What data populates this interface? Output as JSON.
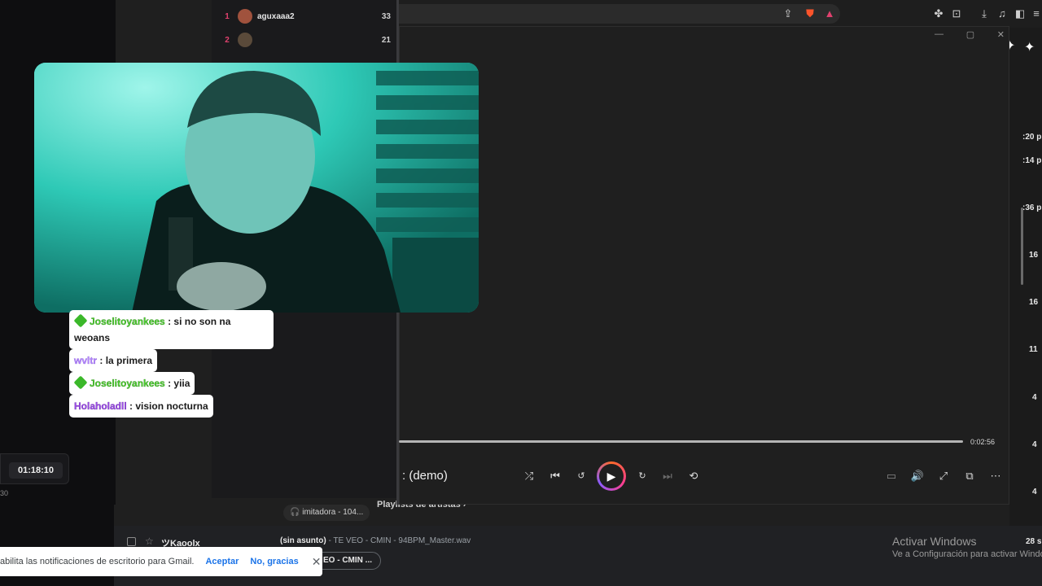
{
  "browser": {
    "icons": [
      "share-icon",
      "brave-icon",
      "rewards-icon",
      "extensions-icon",
      "screenshot-icon",
      "download-icon",
      "media-icon",
      "sidebar-icon",
      "menu-icon"
    ]
  },
  "leaderboard": [
    {
      "rank": "1",
      "name": "aguxaaa2",
      "score": "33"
    },
    {
      "rank": "2",
      "name": "",
      "score": "21"
    }
  ],
  "player": {
    "time": "0:02:56",
    "title": ": (demo)",
    "progress": 1.0
  },
  "chat": [
    {
      "user": "Joselitoyankees",
      "badge": true,
      "text": ": si no son na",
      "text2": "weoans",
      "style": "green"
    },
    {
      "user": "wvltr",
      "badge": false,
      "text": ": la primera",
      "style": "purple"
    },
    {
      "user": "Joselitoyankees",
      "badge": true,
      "text": ": yiia",
      "style": "green"
    },
    {
      "user": "Holaholadll",
      "badge": false,
      "text": ": vision nocturna",
      "style": "violet"
    }
  ],
  "stream": {
    "timer": "01:18:10",
    "small_label": "30"
  },
  "gmail": {
    "tag_label": "imitadora - 104...",
    "section": "Playlists de artistas",
    "sender": "ツKaoolx",
    "subject": "(sin asunto)",
    "snippet": " - TE VEO - CMIN - 94BPM_Master.wav",
    "attachment": "EO - CMIN ...",
    "times": [
      ":20 p",
      ":14 p",
      ":36 p",
      "16",
      "16",
      "11",
      "4",
      "4",
      "4"
    ],
    "last_time": "28 s"
  },
  "notification": {
    "text": "abilita las notificaciones de escritorio para Gmail.",
    "accept": "Aceptar",
    "decline": "No, gracias"
  },
  "watermark": {
    "title": "Activar Windows",
    "subtitle": "Ve a Configuración para activar Windows."
  }
}
